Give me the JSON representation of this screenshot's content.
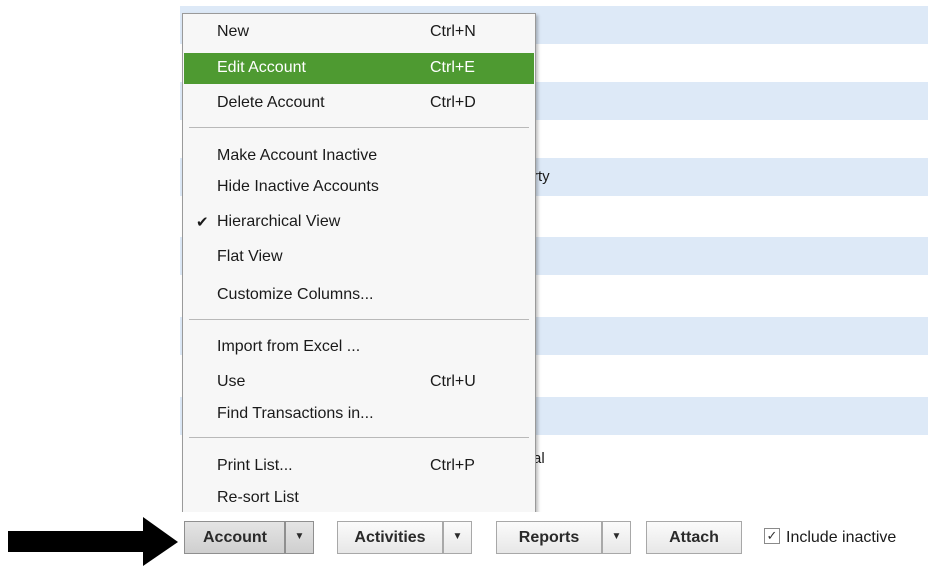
{
  "list": {
    "partial_texts": [
      "rty",
      "al"
    ]
  },
  "menu": {
    "items": [
      {
        "label": "New",
        "shortcut": "Ctrl+N"
      },
      {
        "label": "Edit Account",
        "shortcut": "Ctrl+E"
      },
      {
        "label": "Delete Account",
        "shortcut": "Ctrl+D"
      },
      {
        "label": "Make Account Inactive",
        "shortcut": ""
      },
      {
        "label": "Hide Inactive Accounts",
        "shortcut": ""
      },
      {
        "label": "Hierarchical View",
        "shortcut": "",
        "checked": true,
        "check_mark": "✔"
      },
      {
        "label": "Flat View",
        "shortcut": ""
      },
      {
        "label": "Customize Columns...",
        "shortcut": ""
      },
      {
        "label": "Import from Excel ...",
        "shortcut": ""
      },
      {
        "label": "Use",
        "shortcut": "Ctrl+U"
      },
      {
        "label": "Find Transactions in...",
        "shortcut": ""
      },
      {
        "label": "Print List...",
        "shortcut": "Ctrl+P"
      },
      {
        "label": "Re-sort List",
        "shortcut": ""
      }
    ],
    "highlight_color": "#4e9a31"
  },
  "toolbar": {
    "account_label": "Account",
    "activities_label": "Activities",
    "reports_label": "Reports",
    "attach_label": "Attach",
    "dropdown_glyph": "▼",
    "include_inactive_label": "Include inactive",
    "include_inactive_checked": true,
    "checkbox_glyph": "✓"
  },
  "colors": {
    "row_shade": "#dde9f7",
    "arrow": "#000000"
  }
}
